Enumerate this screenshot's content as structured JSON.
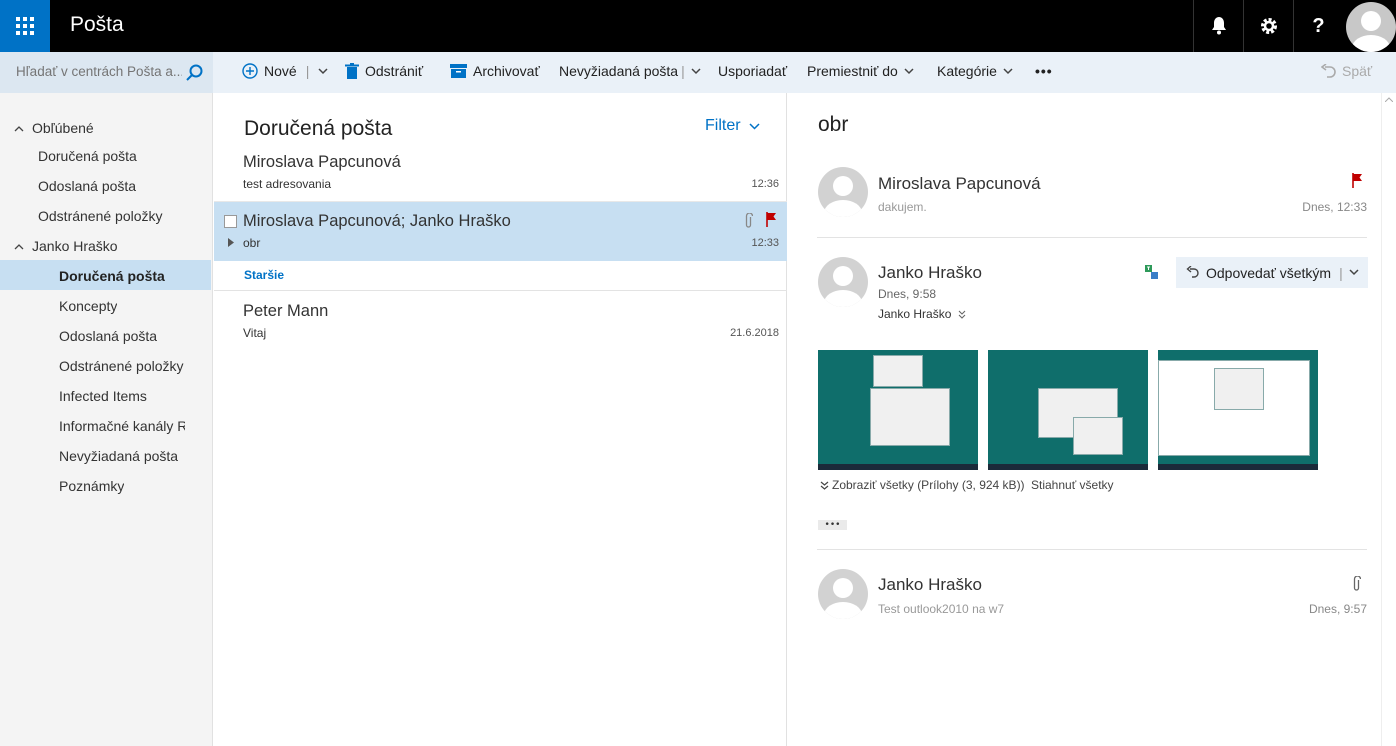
{
  "app": {
    "title": "Pošta"
  },
  "search": {
    "placeholder": "Hľadať v centrách Pošta a..."
  },
  "toolbar": {
    "new_label": "Nové",
    "delete_label": "Odstrániť",
    "archive_label": "Archivovať",
    "junk_label": "Nevyžiadaná pošta",
    "sweep_label": "Usporiadať",
    "move_label": "Premiestniť do",
    "categories_label": "Kategórie",
    "undo_label": "Späť"
  },
  "nav": {
    "favorites_label": "Obľúbené",
    "favorites": [
      "Doručená pošta",
      "Odoslaná pošta",
      "Odstránené položky"
    ],
    "account_label": "Janko Hraško",
    "folders": [
      "Doručená pošta",
      "Koncepty",
      "Odoslaná pošta",
      "Odstránené položky",
      "Infected Items",
      "Informačné kanály RSS",
      "Nevyžiadaná pošta",
      "Poznámky"
    ]
  },
  "list": {
    "title": "Doručená pošta",
    "filter_label": "Filter",
    "older_label": "Staršie",
    "messages": [
      {
        "from": "Miroslava Papcunová",
        "subject": "test adresovania",
        "time": "12:36"
      },
      {
        "from": "Miroslava Papcunová; Janko Hraško",
        "subject": "obr",
        "time": "12:33"
      },
      {
        "from": "Peter Mann",
        "subject": "Vitaj",
        "time": "21.6.2018"
      }
    ]
  },
  "reading": {
    "subject": "obr",
    "items": [
      {
        "from": "Miroslava Papcunová",
        "preview": "dakujem.",
        "time": "Dnes, 12:33"
      },
      {
        "from": "Janko Hraško",
        "date": "Dnes, 9:58",
        "to": "Janko Hraško",
        "reply_all_label": "Odpovedať všetkým",
        "show_all_label": "Zobraziť všetky (Prílohy (3, 924 kB))",
        "download_all_label": "Stiahnuť všetky",
        "more_label": "•••"
      },
      {
        "from": "Janko Hraško",
        "preview": "Test outlook2010 na w7",
        "time": "Dnes, 9:57"
      }
    ]
  },
  "colors": {
    "accent": "#0072c6",
    "selected": "#c7dff2",
    "flag": "#c00000",
    "topbar": "#000000"
  }
}
